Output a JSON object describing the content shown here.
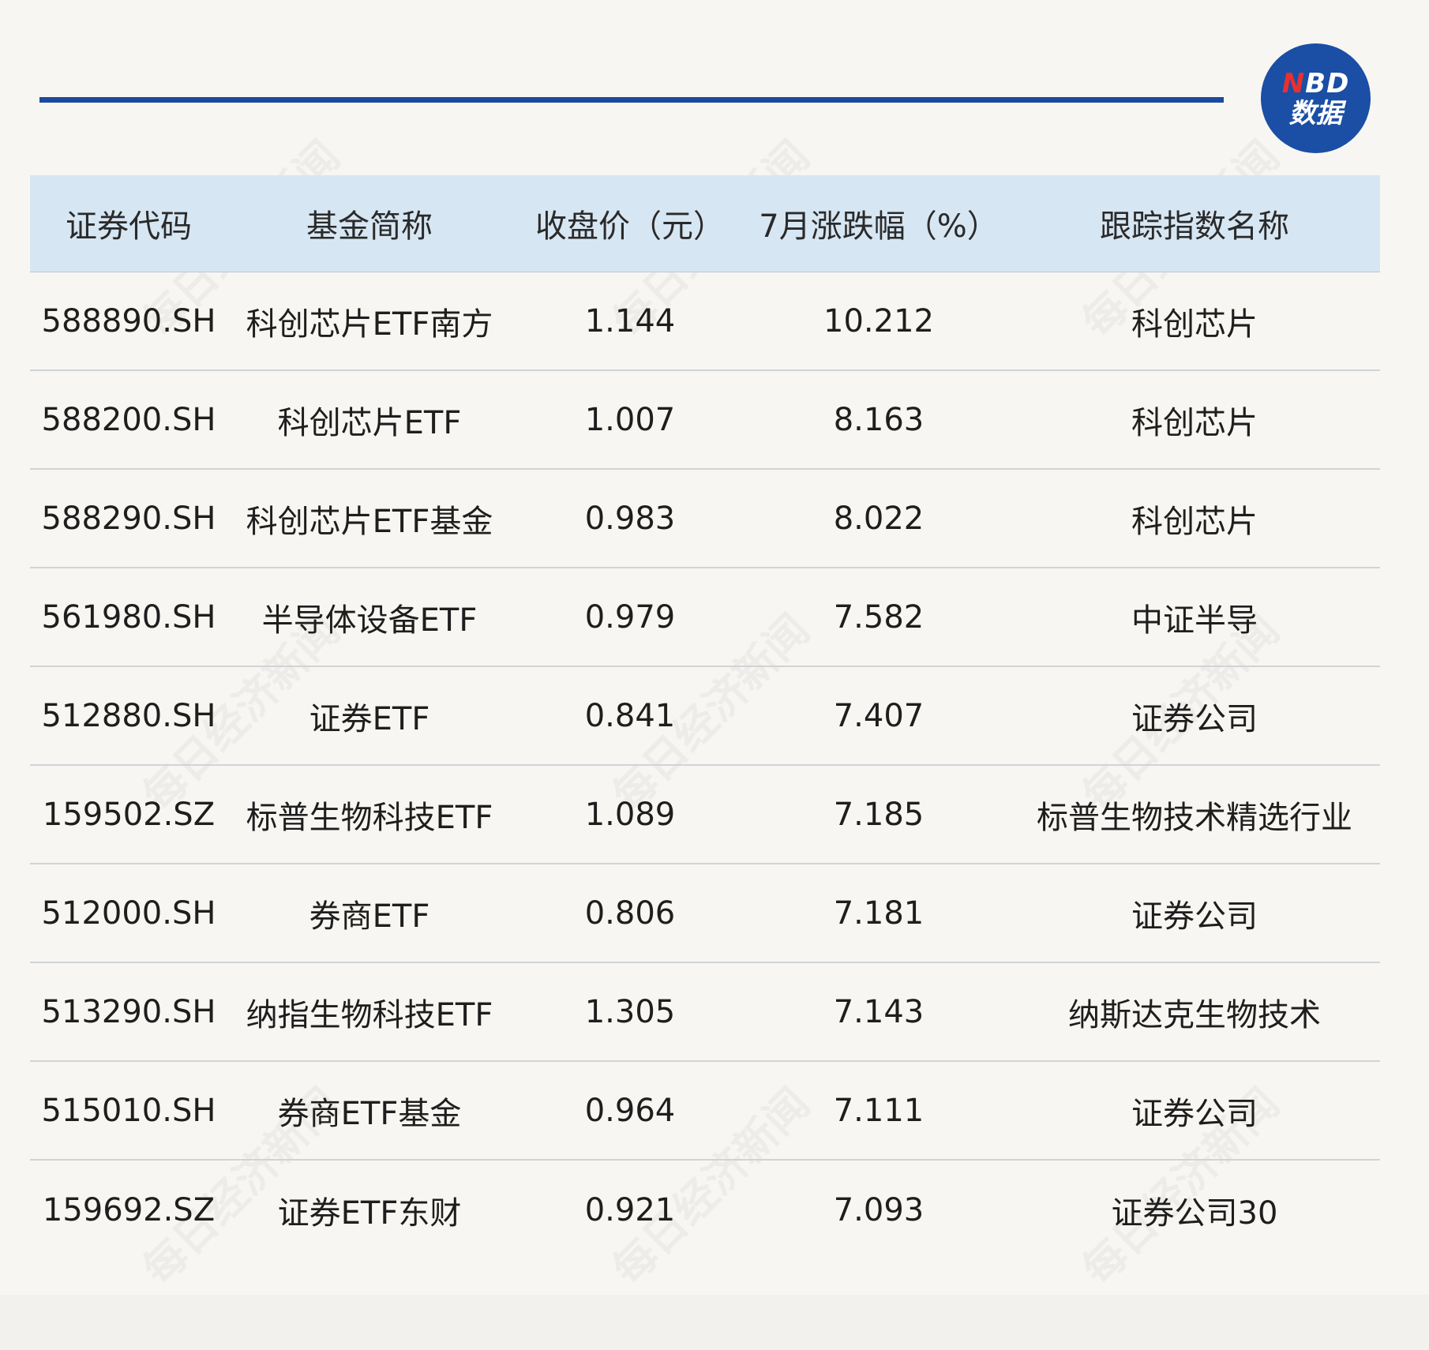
{
  "logo": {
    "line1_n": "N",
    "line1_rest": "BD",
    "line2": "数据"
  },
  "watermark": "每日经济新闻",
  "headers": [
    "证券代码",
    "基金简称",
    "收盘价（元）",
    "7月涨跌幅（%）",
    "跟踪指数名称"
  ],
  "rows": [
    [
      "588890.SH",
      "科创芯片ETF南方",
      "1.144",
      "10.212",
      "科创芯片"
    ],
    [
      "588200.SH",
      "科创芯片ETF",
      "1.007",
      "8.163",
      "科创芯片"
    ],
    [
      "588290.SH",
      "科创芯片ETF基金",
      "0.983",
      "8.022",
      "科创芯片"
    ],
    [
      "561980.SH",
      "半导体设备ETF",
      "0.979",
      "7.582",
      "中证半导"
    ],
    [
      "512880.SH",
      "证券ETF",
      "0.841",
      "7.407",
      "证券公司"
    ],
    [
      "159502.SZ",
      "标普生物科技ETF",
      "1.089",
      "7.185",
      "标普生物技术精选行业"
    ],
    [
      "512000.SH",
      "券商ETF",
      "0.806",
      "7.181",
      "证券公司"
    ],
    [
      "513290.SH",
      "纳指生物科技ETF",
      "1.305",
      "7.143",
      "纳斯达克生物技术"
    ],
    [
      "515010.SH",
      "券商ETF基金",
      "0.964",
      "7.111",
      "证券公司"
    ],
    [
      "159692.SZ",
      "证券ETF东财",
      "0.921",
      "7.093",
      "证券公司30"
    ]
  ],
  "colors": {
    "rule": "#1a4a9c",
    "header_bg": "#d7e6f3",
    "logo_bg": "#1b4ea5",
    "logo_accent": "#e8312f"
  }
}
